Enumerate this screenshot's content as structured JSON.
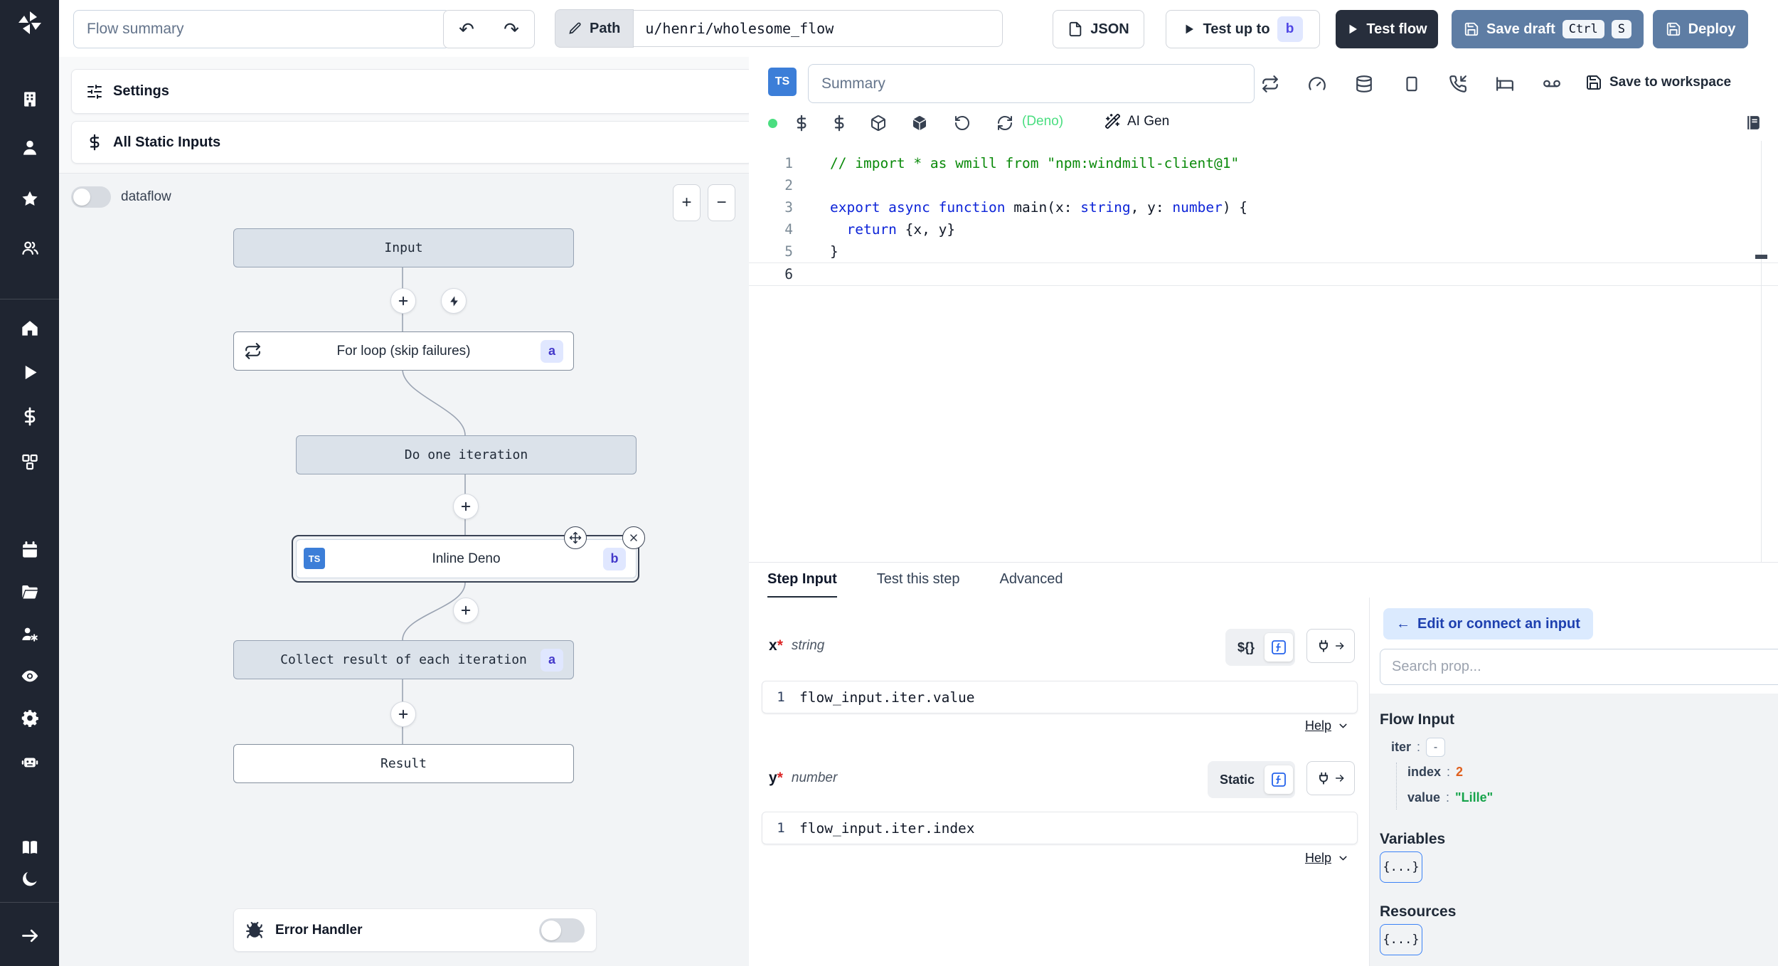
{
  "colors": {
    "sidebar_bg": "#1f2531",
    "typescript_blue": "#3c7ed8",
    "steel_blue_button": "#5e7da4",
    "dark_button": "#272e3c",
    "badge_bg": "#e0e7ff",
    "badge_text": "#4338ca",
    "status_green": "#4ade80",
    "code_comment_green": "#0a8a0a",
    "code_keyword_blue": "#0d24d8",
    "json_number_orange": "#e0601e",
    "json_string_green": "#16a34a",
    "connect_button_bg": "#dbeafe",
    "connect_button_text": "#1e40af"
  },
  "topbar": {
    "flow_summary_placeholder": "Flow summary",
    "undo_icon": "↶",
    "redo_icon": "↷",
    "path_label": "Path",
    "path_value": "u/henri/wholesome_flow",
    "json_label": "JSON",
    "test_up_to_label": "Test up to",
    "test_up_to_badge": "b",
    "test_flow_label": "Test flow",
    "save_draft_label": "Save draft",
    "kbd_ctrl": "Ctrl",
    "kbd_s": "S",
    "deploy_label": "Deploy"
  },
  "sidebar": {
    "icon_names": [
      "windmill-logo",
      "building",
      "user",
      "star",
      "users",
      "home",
      "play",
      "dollar",
      "cubes",
      "calendar",
      "folder",
      "users-gear",
      "eye",
      "gear",
      "robot",
      "book",
      "moon",
      "arrow-right"
    ]
  },
  "flow_panel": {
    "settings_label": "Settings",
    "static_inputs_label": "All Static Inputs",
    "dataflow_label": "dataflow",
    "zoom_in": "+",
    "zoom_out": "−",
    "nodes": {
      "input": "Input",
      "for_loop": "For loop (skip failures)",
      "for_loop_badge": "a",
      "do_one_iteration": "Do one iteration",
      "inline_deno": "Inline Deno",
      "inline_deno_lang": "TS",
      "inline_deno_badge": "b",
      "collect": "Collect result of each iteration",
      "collect_badge": "a",
      "result": "Result"
    },
    "error_handler_label": "Error Handler"
  },
  "editor": {
    "lang_badge": "TS",
    "summary_placeholder": "Summary",
    "save_to_workspace_label": "Save to workspace",
    "deno_label": "(Deno)",
    "ai_gen_label": "AI Gen",
    "line_numbers": [
      "1",
      "2",
      "3",
      "4",
      "5",
      "6"
    ],
    "code": {
      "l1c": "// import * as wmill from \"npm:windmill-client@1\"",
      "l3k1": "export async function",
      "l3p1": " main(x: ",
      "l3k2": "string",
      "l3p2": ", y: ",
      "l3k3": "number",
      "l3p3": ") {",
      "l4p0": "  ",
      "l4k": "return",
      "l4p1": " {x, y}",
      "l5p": "}"
    }
  },
  "step_panel": {
    "tabs": [
      "Step Input",
      "Test this step",
      "Advanced"
    ],
    "fields": [
      {
        "name": "x",
        "required_mark": "*",
        "type": "string",
        "mode_label": "${}",
        "line_number": "1",
        "value": "flow_input.iter.value",
        "help_label": "Help"
      },
      {
        "name": "y",
        "required_mark": "*",
        "type": "number",
        "mode_label": "Static",
        "line_number": "1",
        "value": "flow_input.iter.index",
        "help_label": "Help"
      }
    ]
  },
  "connect_panel": {
    "back_arrow": "←",
    "back_label": "Edit or connect an input",
    "search_placeholder": "Search prop...",
    "flow_input_title": "Flow Input",
    "tree": {
      "root_key": "iter",
      "root_sep": ":",
      "root_toggle": "-",
      "children": [
        {
          "key": "index",
          "sep": ":",
          "value": "2"
        },
        {
          "key": "value",
          "sep": ":",
          "value": "\"Lille\""
        }
      ]
    },
    "variables_title": "Variables",
    "variables_button": "{...}",
    "resources_title": "Resources",
    "resources_button": "{...}"
  }
}
